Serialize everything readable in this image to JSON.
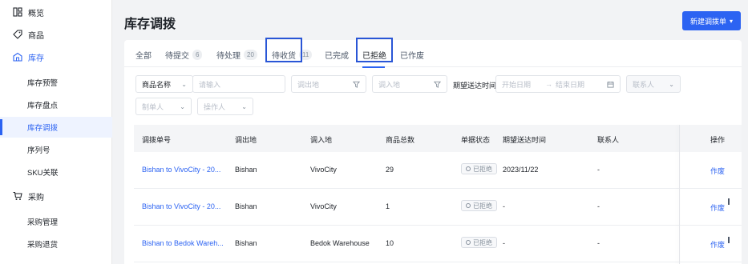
{
  "sidebar": {
    "items": [
      {
        "label": "概览",
        "icon": "dashboard-icon"
      },
      {
        "label": "商品",
        "icon": "tag-icon"
      },
      {
        "label": "库存",
        "icon": "warehouse-icon"
      },
      {
        "label": "库存预警"
      },
      {
        "label": "库存盘点"
      },
      {
        "label": "库存调拨"
      },
      {
        "label": "序列号"
      },
      {
        "label": "SKU关联"
      },
      {
        "label": "采购",
        "icon": "cart-icon"
      },
      {
        "label": "采购管理"
      },
      {
        "label": "采购退货"
      }
    ]
  },
  "header": {
    "title": "库存调拨",
    "new_button": "新建调拨单"
  },
  "tabs": [
    {
      "label": "全部",
      "count": ""
    },
    {
      "label": "待提交",
      "count": "6"
    },
    {
      "label": "待处理",
      "count": "20"
    },
    {
      "label": "待收货",
      "count": "11"
    },
    {
      "label": "已完成",
      "count": ""
    },
    {
      "label": "已拒绝",
      "count": ""
    },
    {
      "label": "已作废",
      "count": ""
    }
  ],
  "filters": {
    "product_name_select": "商品名称",
    "product_input_placeholder": "请输入",
    "from_placeholder": "调出地",
    "to_placeholder": "调入地",
    "expected_label": "期望送达时间",
    "start_date_placeholder": "开始日期",
    "end_date_placeholder": "结束日期",
    "contact_placeholder": "联系人",
    "creator_placeholder": "制单人",
    "operator_placeholder": "操作人"
  },
  "table": {
    "columns": [
      "调拨单号",
      "调出地",
      "调入地",
      "商品总数",
      "单据状态",
      "期望送达时间",
      "联系人",
      "操作"
    ],
    "rows": [
      {
        "no": "Bishan to VivoCity - 20...",
        "from": "Bishan",
        "to": "VivoCity",
        "qty": "29",
        "status": "已拒绝",
        "expected": "2023/11/22",
        "contact": "-",
        "action": "作废"
      },
      {
        "no": "Bishan to VivoCity - 20...",
        "from": "Bishan",
        "to": "VivoCity",
        "qty": "1",
        "status": "已拒绝",
        "expected": "-",
        "contact": "-",
        "action": "作废"
      },
      {
        "no": "Bishan to Bedok Wareh...",
        "from": "Bishan",
        "to": "Bedok Warehouse",
        "qty": "10",
        "status": "已拒绝",
        "expected": "-",
        "contact": "-",
        "action": "作废"
      }
    ]
  },
  "colors": {
    "accent": "#2c63f2",
    "annotation_box": "#2a56d6"
  }
}
